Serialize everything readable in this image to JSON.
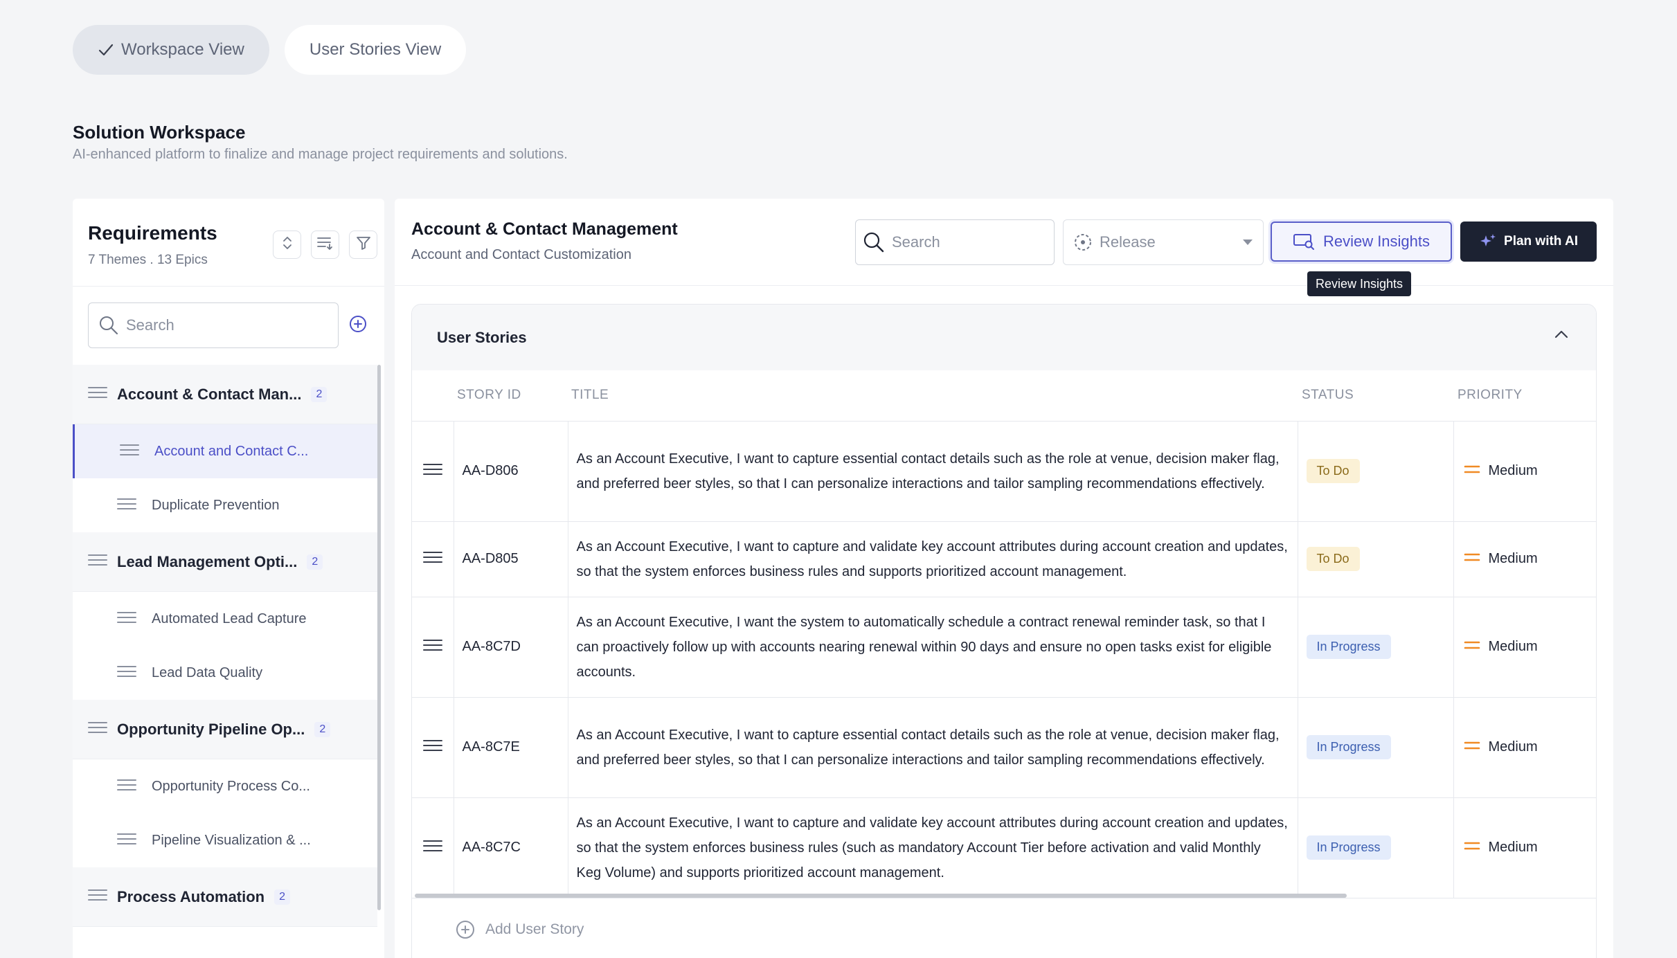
{
  "view_toggle": {
    "workspace_label": "Workspace View",
    "stories_label": "User Stories View"
  },
  "workspace": {
    "title": "Solution Workspace",
    "subtitle": "AI-enhanced platform to finalize and manage project requirements and solutions."
  },
  "requirements": {
    "title": "Requirements",
    "meta": "7 Themes . 13 Epics",
    "search_placeholder": "Search",
    "themes": [
      {
        "label": "Account & Contact Man...",
        "count": "2",
        "epics": [
          "Account and Contact C...",
          "Duplicate Prevention"
        ]
      },
      {
        "label": "Lead Management Opti...",
        "count": "2",
        "epics": [
          "Automated Lead Capture",
          "Lead Data Quality"
        ]
      },
      {
        "label": "Opportunity Pipeline Op...",
        "count": "2",
        "epics": [
          "Opportunity Process Co...",
          "Pipeline Visualization & ..."
        ]
      },
      {
        "label": "Process Automation",
        "count": "2",
        "epics": []
      }
    ]
  },
  "main": {
    "title": "Account & Contact Management",
    "subtitle": "Account and Contact Customization",
    "search_placeholder": "Search",
    "release_placeholder": "Release",
    "review_label": "Review Insights",
    "plan_label": "Plan with AI",
    "tooltip": "Review Insights"
  },
  "stories": {
    "section_title": "User Stories",
    "columns": {
      "id": "STORY ID",
      "title": "TITLE",
      "status": "STATUS",
      "priority": "PRIORITY"
    },
    "rows": [
      {
        "id": "AA-D806",
        "title": "As an Account Executive, I want to capture essential contact details such as the role at venue, decision maker flag, and preferred beer styles, so that I can personalize interactions and tailor sampling recommendations effectively.",
        "status": "To Do",
        "priority": "Medium"
      },
      {
        "id": "AA-D805",
        "title": "As an Account Executive, I want to capture and validate key account attributes during account creation and updates, so that the system enforces business rules and supports prioritized account management.",
        "status": "To Do",
        "priority": "Medium"
      },
      {
        "id": "AA-8C7D",
        "title": "As an Account Executive, I want the system to automatically schedule a contract renewal reminder task, so that I can proactively follow up with accounts nearing renewal within 90 days and ensure no open tasks exist for eligible accounts.",
        "status": "In Progress",
        "priority": "Medium"
      },
      {
        "id": "AA-8C7E",
        "title": "As an Account Executive, I want to capture essential contact details such as the role at venue, decision maker flag, and preferred beer styles, so that I can personalize interactions and tailor sampling recommendations effectively.",
        "status": "In Progress",
        "priority": "Medium"
      },
      {
        "id": "AA-8C7C",
        "title": "As an Account Executive, I want to capture and validate key account attributes during account creation and updates, so that the system enforces business rules (such as mandatory Account Tier before activation and valid Monthly Keg Volume) and supports prioritized account management.",
        "status": "In Progress",
        "priority": "Medium"
      }
    ],
    "add_label": "Add User Story"
  },
  "colors": {
    "accent": "#4b4fc7",
    "dark": "#1c2232",
    "priority": "#f08a24"
  }
}
